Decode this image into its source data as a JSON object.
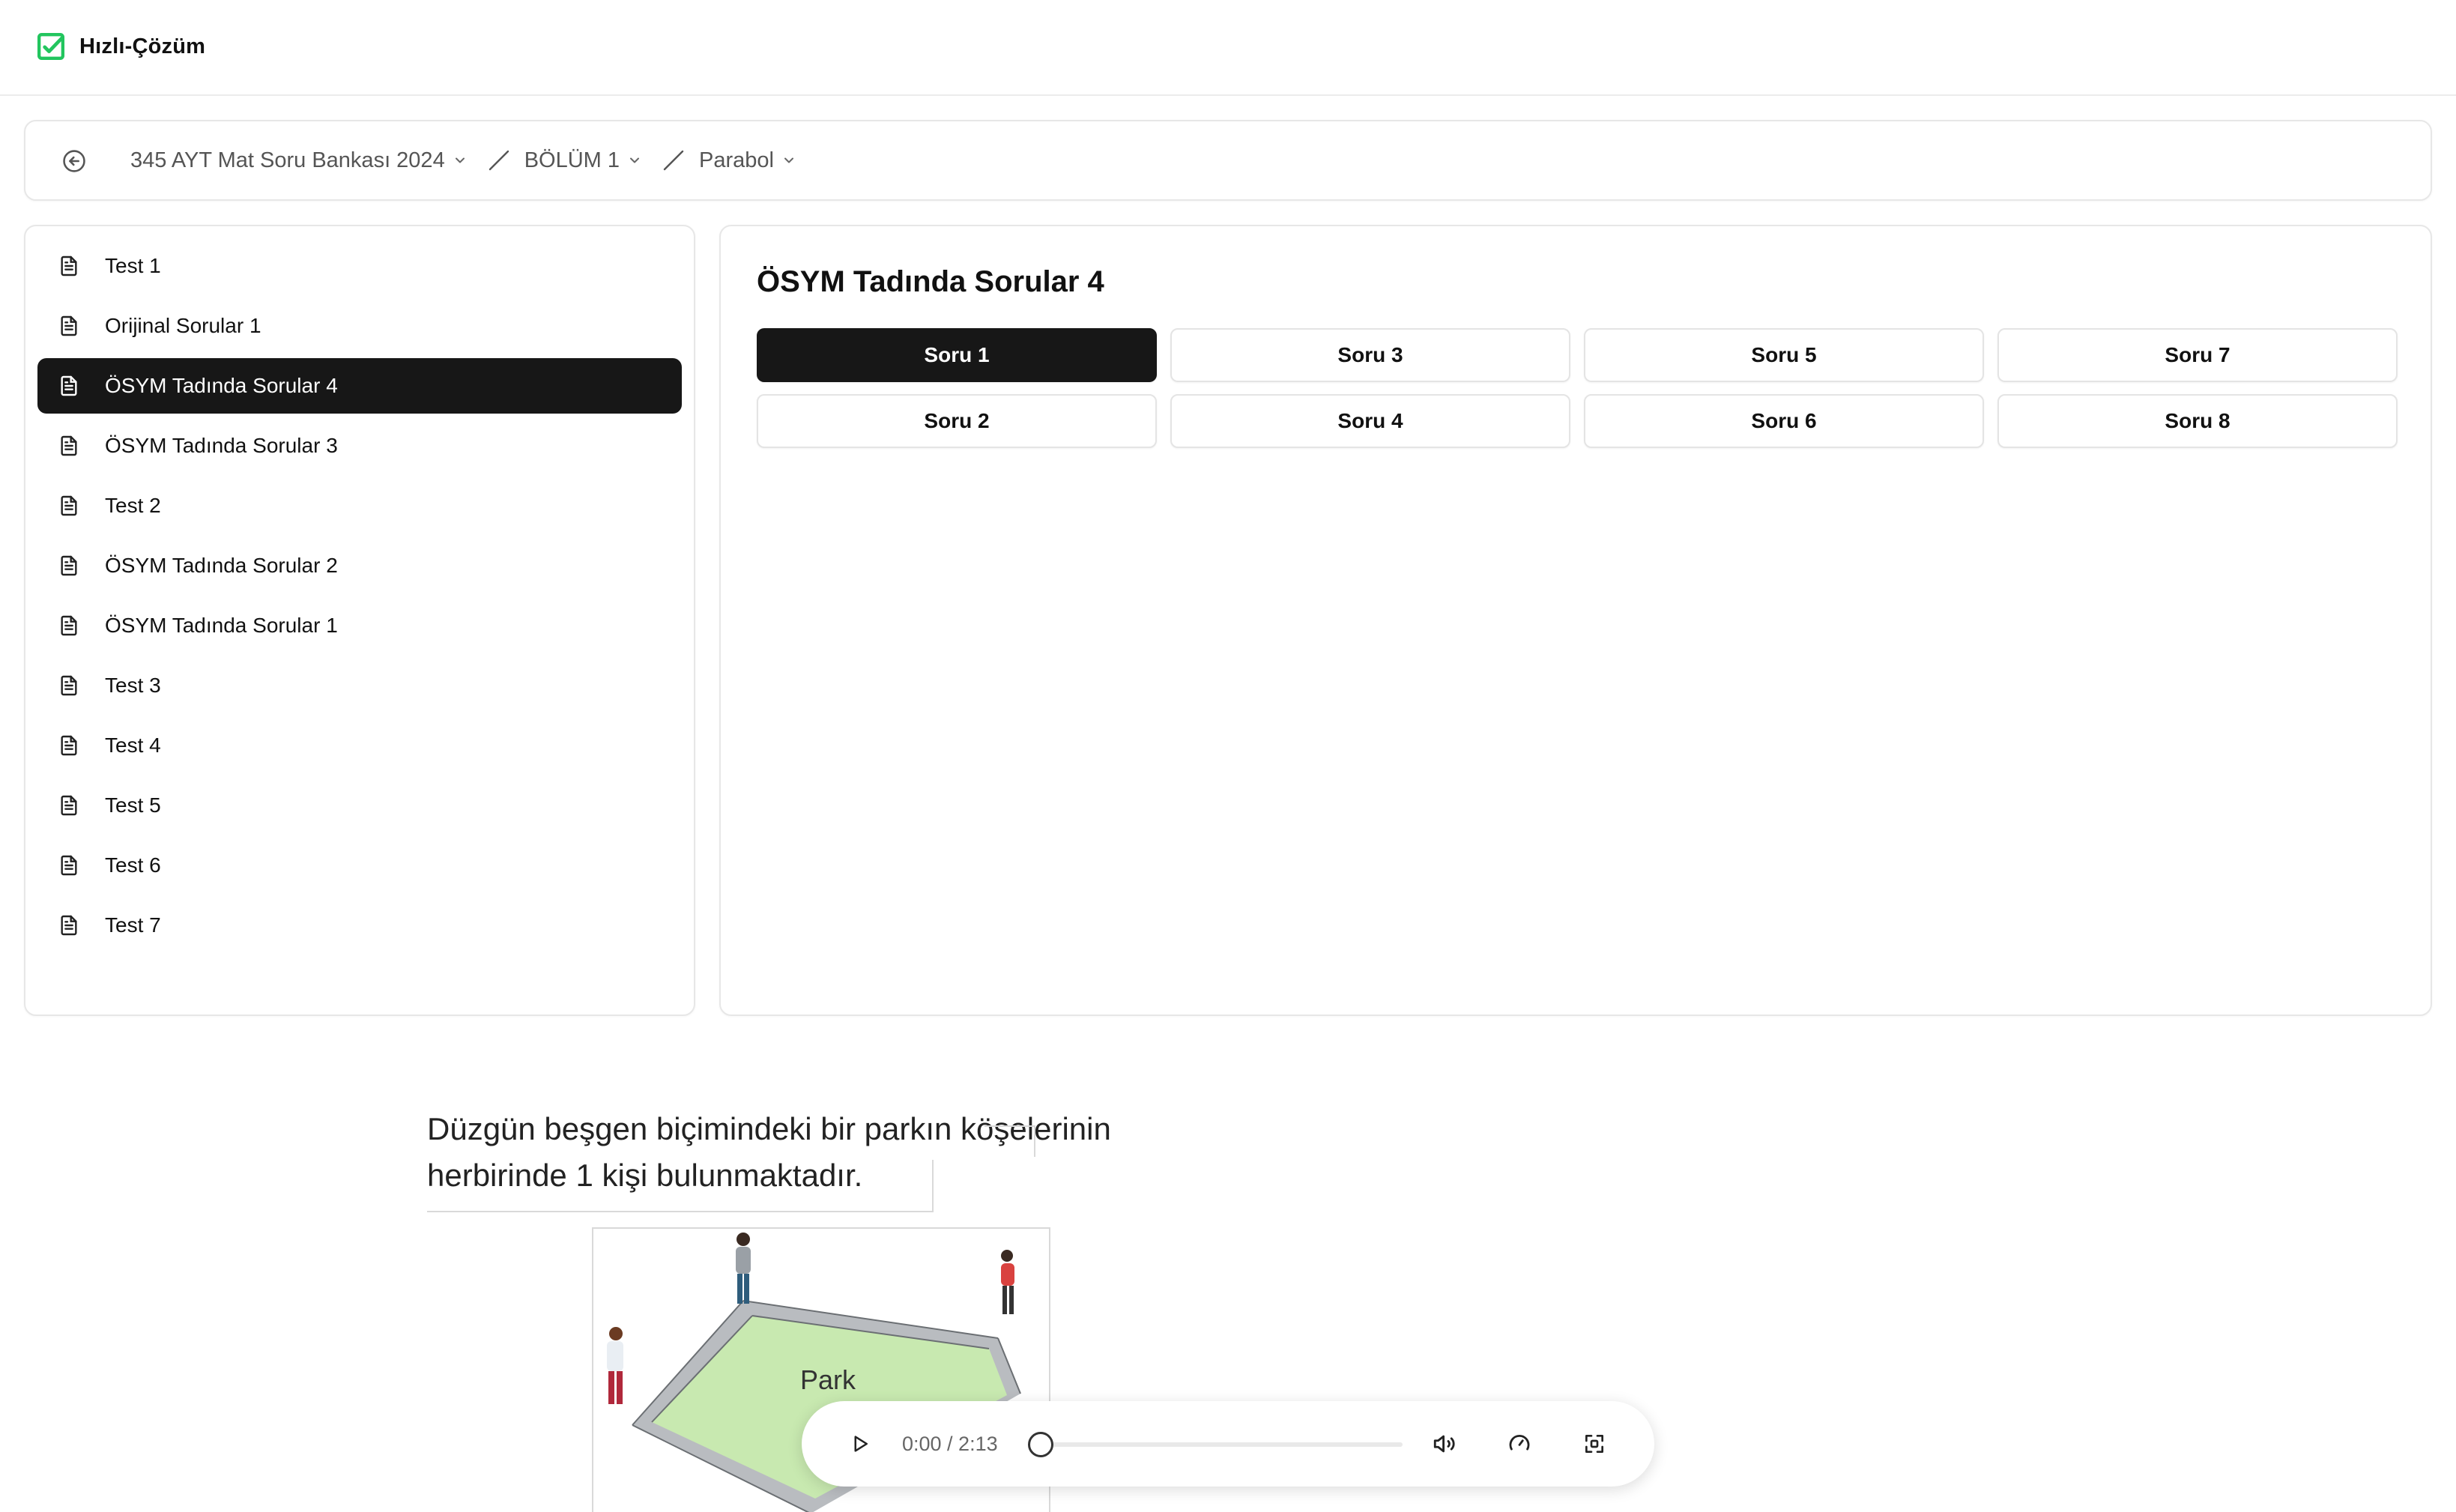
{
  "app": {
    "name": "Hızlı-Çözüm",
    "accent": "#22c55e"
  },
  "breadcrumb": {
    "items": [
      {
        "label": "345 AYT Mat Soru Bankası 2024"
      },
      {
        "label": "BÖLÜM 1"
      },
      {
        "label": "Parabol"
      }
    ]
  },
  "sidebar": {
    "items": [
      {
        "label": "Test 1",
        "active": false
      },
      {
        "label": "Orijinal Sorular 1",
        "active": false
      },
      {
        "label": "ÖSYM Tadında Sorular 4",
        "active": true
      },
      {
        "label": "ÖSYM Tadında Sorular 3",
        "active": false
      },
      {
        "label": "Test 2",
        "active": false
      },
      {
        "label": "ÖSYM Tadında Sorular 2",
        "active": false
      },
      {
        "label": "ÖSYM Tadında Sorular 1",
        "active": false
      },
      {
        "label": "Test 3",
        "active": false
      },
      {
        "label": "Test 4",
        "active": false
      },
      {
        "label": "Test 5",
        "active": false
      },
      {
        "label": "Test 6",
        "active": false
      },
      {
        "label": "Test 7",
        "active": false
      }
    ]
  },
  "main": {
    "title": "ÖSYM Tadında Sorular 4",
    "questions": [
      {
        "label": "Soru 1",
        "active": true
      },
      {
        "label": "Soru 2",
        "active": false
      },
      {
        "label": "Soru 3",
        "active": false
      },
      {
        "label": "Soru 4",
        "active": false
      },
      {
        "label": "Soru 5",
        "active": false
      },
      {
        "label": "Soru 6",
        "active": false
      },
      {
        "label": "Soru 7",
        "active": false
      },
      {
        "label": "Soru 8",
        "active": false
      }
    ]
  },
  "question": {
    "line1": "Düzgün beşgen biçimindeki bir parkın köşelerinin",
    "line2": "herbirinde 1 kişi bulunmaktadır.",
    "figure_label": "Park"
  },
  "player": {
    "time": "0:00 / 2:13",
    "progress": 0
  }
}
